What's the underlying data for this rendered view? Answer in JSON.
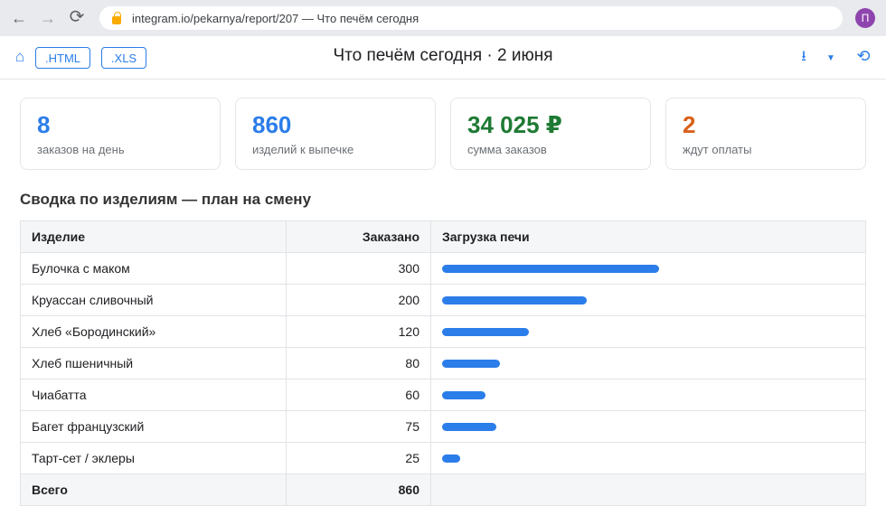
{
  "browser": {
    "url": "integram.io/pekarnya/report/207",
    "tab_title": "Что печём сегодня",
    "url_separator": " — ",
    "avatar_letter": "П",
    "accent_color": "#8e44ad"
  },
  "header": {
    "export_html_label": ".HTML",
    "export_xls_label": ".XLS",
    "title": "Что печём сегодня · 2 июня",
    "accent_color": "#2b7de9"
  },
  "kpis": [
    {
      "value": "8",
      "label": "заказов на день",
      "color": "#2b7de9"
    },
    {
      "value": "860",
      "label": "изделий к выпечке",
      "color": "#2b7de9"
    },
    {
      "value": "34 025 ₽",
      "label": "сумма заказов",
      "color": "#1e7a34"
    },
    {
      "value": "2",
      "label": "ждут оплаты",
      "color": "#d9601a"
    }
  ],
  "section_title": "Сводка по изделиям — план на смену",
  "table": {
    "columns": [
      "Изделие",
      "Заказано",
      "Загрузка печи"
    ],
    "max_value": 300,
    "rows": [
      {
        "name": "Булочка с маком",
        "qty": 300
      },
      {
        "name": "Круассан сливочный",
        "qty": 200
      },
      {
        "name": "Хлеб «Бородинский»",
        "qty": 120
      },
      {
        "name": "Хлеб пшеничный",
        "qty": 80
      },
      {
        "name": "Чиабатта",
        "qty": 60
      },
      {
        "name": "Багет французский",
        "qty": 75
      },
      {
        "name": "Тарт-сет / эклеры",
        "qty": 25
      }
    ],
    "total_label": "Всего",
    "total_value": "860"
  }
}
